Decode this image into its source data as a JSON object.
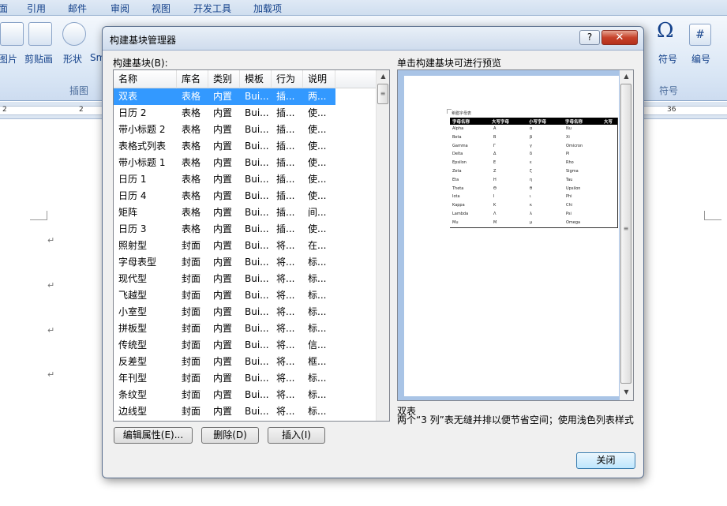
{
  "ribbon": {
    "tabs": [
      "引用",
      "邮件",
      "审阅",
      "视图",
      "开发工具",
      "加载项"
    ],
    "buttons": {
      "picture": "图片",
      "clipart": "剪贴画",
      "shape": "形状",
      "smartart": "Sm",
      "symbol": "符号",
      "number": "编号",
      "omega": "Ω",
      "hash": "#"
    },
    "groups": {
      "illustrations": "插图",
      "symbols": "符号"
    }
  },
  "ruler": {
    "marks": [
      "2",
      "2",
      "36"
    ]
  },
  "document": {
    "para_mark": "↵"
  },
  "dialog": {
    "title": "构建基块管理器",
    "help": "?",
    "close": "✕",
    "list_label": "构建基块(B):",
    "preview_label": "单击构建基块可进行预览",
    "columns": [
      "名称",
      "库名",
      "类别",
      "模板",
      "行为",
      "说明"
    ],
    "rows": [
      [
        "双表",
        "表格",
        "内置",
        "Bui...",
        "插...",
        "两..."
      ],
      [
        "日历 2",
        "表格",
        "内置",
        "Bui...",
        "插...",
        "使..."
      ],
      [
        "带小标题 2",
        "表格",
        "内置",
        "Bui...",
        "插...",
        "使..."
      ],
      [
        "表格式列表",
        "表格",
        "内置",
        "Bui...",
        "插...",
        "使..."
      ],
      [
        "带小标题 1",
        "表格",
        "内置",
        "Bui...",
        "插...",
        "使..."
      ],
      [
        "日历 1",
        "表格",
        "内置",
        "Bui...",
        "插...",
        "使..."
      ],
      [
        "日历 4",
        "表格",
        "内置",
        "Bui...",
        "插...",
        "使..."
      ],
      [
        "矩阵",
        "表格",
        "内置",
        "Bui...",
        "插...",
        "间..."
      ],
      [
        "日历 3",
        "表格",
        "内置",
        "Bui...",
        "插...",
        "使..."
      ],
      [
        "照射型",
        "封面",
        "内置",
        "Bui...",
        "将...",
        "在..."
      ],
      [
        "字母表型",
        "封面",
        "内置",
        "Bui...",
        "将...",
        "标..."
      ],
      [
        "现代型",
        "封面",
        "内置",
        "Bui...",
        "将...",
        "标..."
      ],
      [
        "飞越型",
        "封面",
        "内置",
        "Bui...",
        "将...",
        "标..."
      ],
      [
        "小室型",
        "封面",
        "内置",
        "Bui...",
        "将...",
        "标..."
      ],
      [
        "拼板型",
        "封面",
        "内置",
        "Bui...",
        "将...",
        "标..."
      ],
      [
        "传统型",
        "封面",
        "内置",
        "Bui...",
        "将...",
        "信..."
      ],
      [
        "反差型",
        "封面",
        "内置",
        "Bui...",
        "将...",
        "框..."
      ],
      [
        "年刊型",
        "封面",
        "内置",
        "Bui...",
        "将...",
        "标..."
      ],
      [
        "条纹型",
        "封面",
        "内置",
        "Bui...",
        "将...",
        "标..."
      ],
      [
        "边线型",
        "封面",
        "内置",
        "Bui...",
        "将...",
        "标..."
      ]
    ],
    "selected_row": 0,
    "preview": {
      "table_title": "希腊字母表",
      "headers": [
        "字母名称",
        "大写字母",
        "小写字母",
        "字母名称",
        "大写"
      ],
      "rows": [
        [
          "Alpha",
          "Α",
          "α",
          "Nu"
        ],
        [
          "Beta",
          "Β",
          "β",
          "Xi"
        ],
        [
          "Gamma",
          "Γ",
          "γ",
          "Omicron"
        ],
        [
          "Delta",
          "Δ",
          "δ",
          "Pi"
        ],
        [
          "Epsilon",
          "Ε",
          "ε",
          "Rho"
        ],
        [
          "Zeta",
          "Ζ",
          "ζ",
          "Sigma"
        ],
        [
          "Eta",
          "Η",
          "η",
          "Tau"
        ],
        [
          "Theta",
          "Θ",
          "θ",
          "Upsilon"
        ],
        [
          "Iota",
          "Ι",
          "ι",
          "Phi"
        ],
        [
          "Kappa",
          "Κ",
          "κ",
          "Chi"
        ],
        [
          "Lambda",
          "Λ",
          "λ",
          "Psi"
        ],
        [
          "Mu",
          "Μ",
          "μ",
          "Omega"
        ]
      ]
    },
    "description_name": "双表",
    "description_text": "两个“3 列”表无缝并排以便节省空间；使用浅色列表样式",
    "buttons": {
      "edit": "编辑属性(E)...",
      "delete": "删除(D)",
      "insert": "插入(I)",
      "close": "关闭"
    }
  },
  "icons": {
    "scroll_up": "▲",
    "scroll_down": "▼",
    "grip": "≡"
  }
}
